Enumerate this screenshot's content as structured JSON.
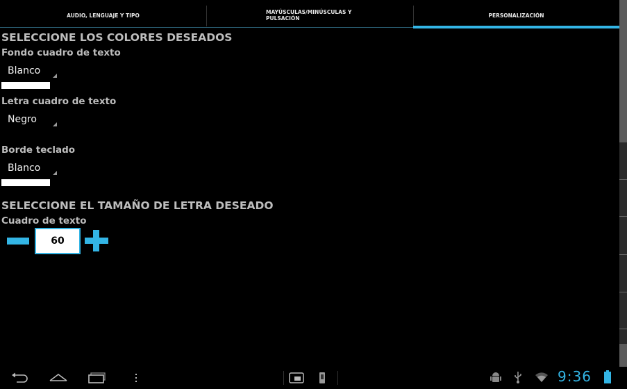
{
  "tabs": [
    {
      "label": "AUDIO, LENGUAJE Y TIPO"
    },
    {
      "label_line1": "MAYÚSCULAS/MINÚSCULAS Y",
      "label_line2": "PULSACIÓN"
    },
    {
      "label": "PERSONALIZACIÓN",
      "selected": true
    }
  ],
  "colors_section": {
    "title": "SELECCIONE LOS COLORES DESEADOS",
    "fields": [
      {
        "label": "Fondo cuadro de texto",
        "value": "Blanco",
        "swatch": "#ffffff"
      },
      {
        "label": "Letra cuadro de texto",
        "value": "Negro",
        "swatch": "#000000"
      },
      {
        "label": "Borde teclado",
        "value": "Blanco",
        "swatch": "#ffffff"
      }
    ]
  },
  "size_section": {
    "title": "SELECCIONE EL TAMAÑO DE LETRA DESEADO",
    "label": "Cuadro de texto",
    "value": "60"
  },
  "system_bar": {
    "time": "9:36",
    "icons": [
      "back-icon",
      "home-icon",
      "recent-apps-icon",
      "menu-icon",
      "screenshot-icon",
      "phone-icon",
      "android-debug-icon",
      "usb-icon",
      "wifi-icon",
      "battery-icon"
    ]
  },
  "theme": {
    "accent": "#33b5e5",
    "background": "#000000",
    "text": "#bdbdbd"
  }
}
